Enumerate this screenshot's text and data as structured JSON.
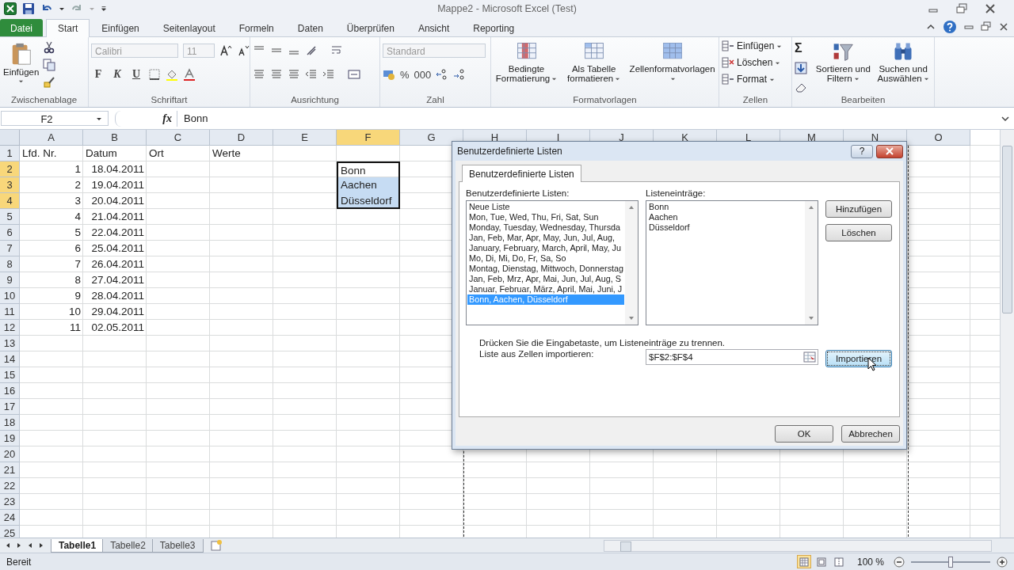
{
  "window": {
    "title": "Mappe2 - Microsoft Excel (Test)"
  },
  "ribbon_tabs": [
    {
      "label": "Datei",
      "kind": "file",
      "selected": false
    },
    {
      "label": "Start",
      "kind": "tab",
      "selected": true
    },
    {
      "label": "Einfügen",
      "kind": "tab",
      "selected": false
    },
    {
      "label": "Seitenlayout",
      "kind": "tab",
      "selected": false
    },
    {
      "label": "Formeln",
      "kind": "tab",
      "selected": false
    },
    {
      "label": "Daten",
      "kind": "tab",
      "selected": false
    },
    {
      "label": "Überprüfen",
      "kind": "tab",
      "selected": false
    },
    {
      "label": "Ansicht",
      "kind": "tab",
      "selected": false
    },
    {
      "label": "Reporting",
      "kind": "tab",
      "selected": false
    }
  ],
  "ribbon_groups": [
    {
      "kind": "clipboard",
      "label": "Zwischenablage",
      "paste_label": "Einfügen"
    },
    {
      "kind": "font",
      "label": "Schriftart",
      "font_name": "Calibri",
      "font_size": "11",
      "disabled": true,
      "style_buttons": [
        "F",
        "K",
        "U"
      ]
    },
    {
      "kind": "alignment",
      "label": "Ausrichtung"
    },
    {
      "kind": "number",
      "label": "Zahl",
      "format": "Standard",
      "disabled": true,
      "buttons": [
        "%",
        "000"
      ]
    },
    {
      "kind": "styles",
      "label": "Formatvorlagen",
      "commands": [
        "Bedingte Formatierung",
        "Als Tabelle formatieren",
        "Zellenformatvorlagen"
      ]
    },
    {
      "kind": "cells",
      "label": "Zellen",
      "commands": [
        "Einfügen",
        "Löschen",
        "Format"
      ]
    },
    {
      "kind": "editing",
      "label": "Bearbeiten",
      "sum_symbol": "Σ",
      "commands": [
        "Sortieren und Filtern",
        "Suchen und Auswählen"
      ]
    }
  ],
  "formula_bar": {
    "name_box": "F2",
    "function_label": "fx",
    "value": "Bonn"
  },
  "columns": [
    {
      "label": "A",
      "selected": false
    },
    {
      "label": "B",
      "selected": false
    },
    {
      "label": "C",
      "selected": false
    },
    {
      "label": "D",
      "selected": false
    },
    {
      "label": "E",
      "selected": false
    },
    {
      "label": "F",
      "selected": true
    },
    {
      "label": "G",
      "selected": false
    },
    {
      "label": "H",
      "selected": false
    },
    {
      "label": "I",
      "selected": false
    },
    {
      "label": "J",
      "selected": false
    },
    {
      "label": "K",
      "selected": false
    },
    {
      "label": "L",
      "selected": false
    },
    {
      "label": "M",
      "selected": false
    },
    {
      "label": "N",
      "selected": false
    },
    {
      "label": "O",
      "selected": false
    }
  ],
  "rows": [
    {
      "number": "1",
      "selected": false,
      "cells": {
        "A": {
          "text": "Lfd. Nr.",
          "kind": "text"
        },
        "B": {
          "text": "Datum",
          "kind": "text"
        },
        "C": {
          "text": "Ort",
          "kind": "text"
        },
        "D": {
          "text": "Werte",
          "kind": "text"
        }
      }
    },
    {
      "number": "2",
      "selected": true,
      "cells": {
        "A": {
          "text": "1",
          "kind": "number"
        },
        "B": {
          "text": "18.04.2011",
          "kind": "number"
        },
        "F": {
          "text": "Bonn",
          "kind": "text",
          "active": true
        }
      }
    },
    {
      "number": "3",
      "selected": true,
      "cells": {
        "A": {
          "text": "2",
          "kind": "number"
        },
        "B": {
          "text": "19.04.2011",
          "kind": "number"
        },
        "F": {
          "text": "Aachen",
          "kind": "text"
        }
      }
    },
    {
      "number": "4",
      "selected": true,
      "cells": {
        "A": {
          "text": "3",
          "kind": "number"
        },
        "B": {
          "text": "20.04.2011",
          "kind": "number"
        },
        "F": {
          "text": "Düsseldorf",
          "kind": "text"
        }
      }
    },
    {
      "number": "5",
      "selected": false,
      "cells": {
        "A": {
          "text": "4",
          "kind": "number"
        },
        "B": {
          "text": "21.04.2011",
          "kind": "number"
        }
      }
    },
    {
      "number": "6",
      "selected": false,
      "cells": {
        "A": {
          "text": "5",
          "kind": "number"
        },
        "B": {
          "text": "22.04.2011",
          "kind": "number"
        }
      }
    },
    {
      "number": "7",
      "selected": false,
      "cells": {
        "A": {
          "text": "6",
          "kind": "number"
        },
        "B": {
          "text": "25.04.2011",
          "kind": "number"
        }
      }
    },
    {
      "number": "8",
      "selected": false,
      "cells": {
        "A": {
          "text": "7",
          "kind": "number"
        },
        "B": {
          "text": "26.04.2011",
          "kind": "number"
        }
      }
    },
    {
      "number": "9",
      "selected": false,
      "cells": {
        "A": {
          "text": "8",
          "kind": "number"
        },
        "B": {
          "text": "27.04.2011",
          "kind": "number"
        }
      }
    },
    {
      "number": "10",
      "selected": false,
      "cells": {
        "A": {
          "text": "9",
          "kind": "number"
        },
        "B": {
          "text": "28.04.2011",
          "kind": "number"
        }
      }
    },
    {
      "number": "11",
      "selected": false,
      "cells": {
        "A": {
          "text": "10",
          "kind": "number"
        },
        "B": {
          "text": "29.04.2011",
          "kind": "number"
        }
      }
    },
    {
      "number": "12",
      "selected": false,
      "cells": {
        "A": {
          "text": "11",
          "kind": "number"
        },
        "B": {
          "text": "02.05.2011",
          "kind": "number"
        }
      }
    },
    {
      "number": "13",
      "selected": false,
      "cells": {}
    },
    {
      "number": "14",
      "selected": false,
      "cells": {}
    },
    {
      "number": "15",
      "selected": false,
      "cells": {}
    },
    {
      "number": "16",
      "selected": false,
      "cells": {}
    },
    {
      "number": "17",
      "selected": false,
      "cells": {}
    },
    {
      "number": "18",
      "selected": false,
      "cells": {}
    },
    {
      "number": "19",
      "selected": false,
      "cells": {}
    },
    {
      "number": "20",
      "selected": false,
      "cells": {}
    },
    {
      "number": "21",
      "selected": false,
      "cells": {}
    },
    {
      "number": "22",
      "selected": false,
      "cells": {}
    },
    {
      "number": "23",
      "selected": false,
      "cells": {}
    },
    {
      "number": "24",
      "selected": false,
      "cells": {}
    },
    {
      "number": "25",
      "selected": false,
      "cells": {}
    }
  ],
  "dialog": {
    "title": "Benutzerdefinierte Listen",
    "help_label": "?",
    "tabs": [
      {
        "label": "Benutzerdefinierte Listen",
        "selected": true
      }
    ],
    "lists_label": "Benutzerdefinierte Listen:",
    "lists": [
      {
        "label": "Neue Liste",
        "selected": false
      },
      {
        "label": "Mon, Tue, Wed, Thu, Fri, Sat, Sun",
        "selected": false
      },
      {
        "label": "Monday, Tuesday, Wednesday, Thursda",
        "selected": false
      },
      {
        "label": "Jan, Feb, Mar, Apr, May, Jun, Jul, Aug,",
        "selected": false
      },
      {
        "label": "January, February, March, April, May, Ju",
        "selected": false
      },
      {
        "label": "Mo, Di, Mi, Do, Fr, Sa, So",
        "selected": false
      },
      {
        "label": "Montag, Dienstag, Mittwoch, Donnerstag",
        "selected": false
      },
      {
        "label": "Jan, Feb, Mrz, Apr, Mai, Jun, Jul, Aug, S",
        "selected": false
      },
      {
        "label": "Januar, Februar, März, April, Mai, Juni, J",
        "selected": false
      },
      {
        "label": "Bonn, Aachen, Düsseldorf",
        "selected": true
      }
    ],
    "entries_label": "Listeneinträge:",
    "entries": [
      "Bonn",
      "Aachen",
      "Düsseldorf"
    ],
    "side_buttons": [
      "Hinzufügen",
      "Löschen"
    ],
    "hint": "Drücken Sie die Eingabetaste, um Listeneinträge zu trennen.",
    "import_label": "Liste aus Zellen importieren:",
    "import_value": "$F$2:$F$4",
    "import_button": {
      "label": "Importieren",
      "focused": true
    },
    "buttons": [
      "OK",
      "Abbrechen"
    ]
  },
  "sheets": [
    {
      "label": "Tabelle1",
      "selected": true
    },
    {
      "label": "Tabelle2",
      "selected": false
    },
    {
      "label": "Tabelle3",
      "selected": false
    }
  ],
  "status_bar": {
    "status": "Bereit",
    "zoom": "100 %",
    "zoom_slider": {
      "level": 0.5
    },
    "views": [
      {
        "kind": "normal",
        "selected": true
      },
      {
        "kind": "layout",
        "selected": false
      },
      {
        "kind": "pagebreak",
        "selected": false
      }
    ]
  }
}
